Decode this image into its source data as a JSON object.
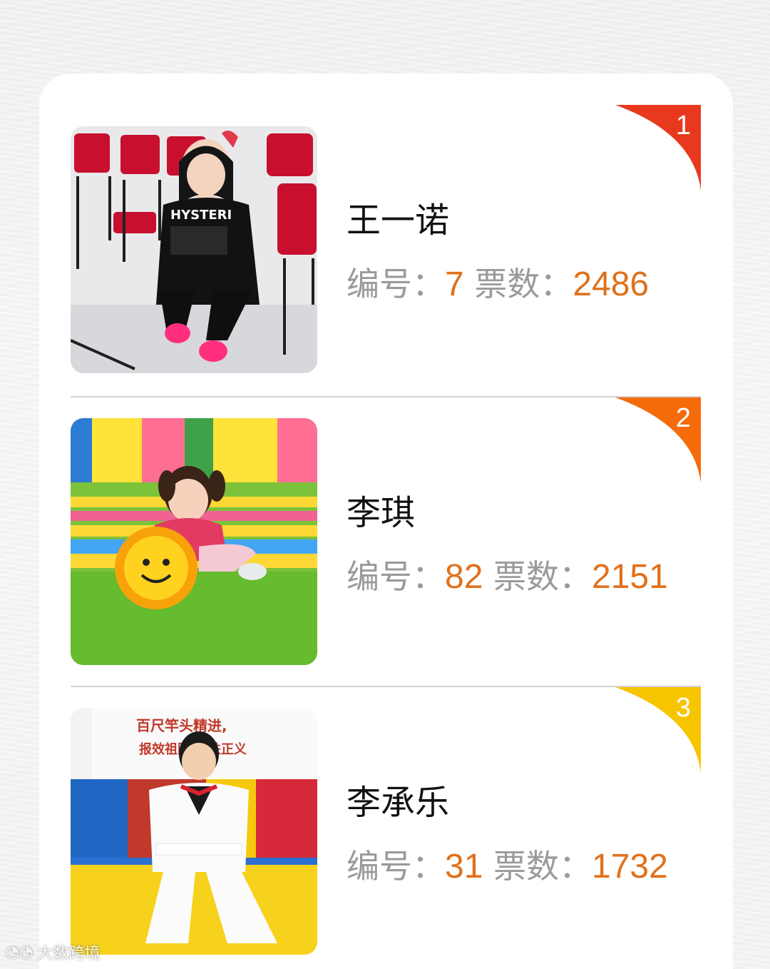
{
  "labels": {
    "id_label": "编号：",
    "votes_label": "票数："
  },
  "entries": [
    {
      "rank": "1",
      "name": "王一诺",
      "id": "7",
      "votes": "2486",
      "ribbon_color": "#e8391f",
      "shirt_text": "HYSTERI"
    },
    {
      "rank": "2",
      "name": "李琪",
      "id": "82",
      "votes": "2151",
      "ribbon_color": "#f56b0a"
    },
    {
      "rank": "3",
      "name": "李承乐",
      "id": "31",
      "votes": "1732",
      "ribbon_color": "#f7c400",
      "banner_text": "百尺竿头精进, 报效祖国,匡扶正义"
    }
  ],
  "watermark": {
    "text": "大数跨境"
  },
  "colors": {
    "accent": "#e0711b",
    "label": "#9a9a9a"
  }
}
